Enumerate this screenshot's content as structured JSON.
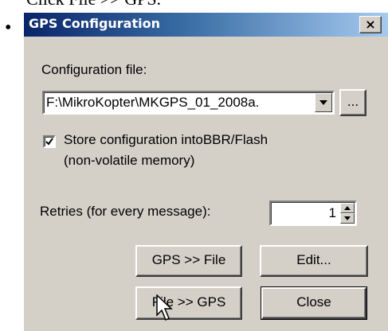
{
  "page": {
    "top_text": "Click File >> GPS.",
    "bullet": "•"
  },
  "dialog": {
    "title": "GPS Configuration",
    "close_glyph": "×",
    "config_file_label": "Configuration file:",
    "config_file_value": "F:\\MikroKopter\\MKGPS_01_2008a.",
    "browse_label": "...",
    "store_checked": true,
    "store_label_line1": "Store configuration intoBBR/Flash",
    "store_label_line2": "(non-volatile memory)",
    "retries_label": "Retries (for every message):",
    "retries_value": "1",
    "gps_to_file_label": "GPS >> File",
    "edit_label": "Edit...",
    "file_to_gps_label": "File >> GPS",
    "close_label": "Close"
  },
  "icons": {
    "titlebar_close": "close-icon",
    "combo_arrow": "chevron-down-icon",
    "spin_up": "chevron-up-icon",
    "spin_down": "chevron-down-icon",
    "cursor": "mouse-cursor-icon"
  },
  "colors": {
    "titlebar_start": "#0a246a",
    "titlebar_end": "#a6caf0",
    "dialog_face": "#d4d0c8"
  }
}
